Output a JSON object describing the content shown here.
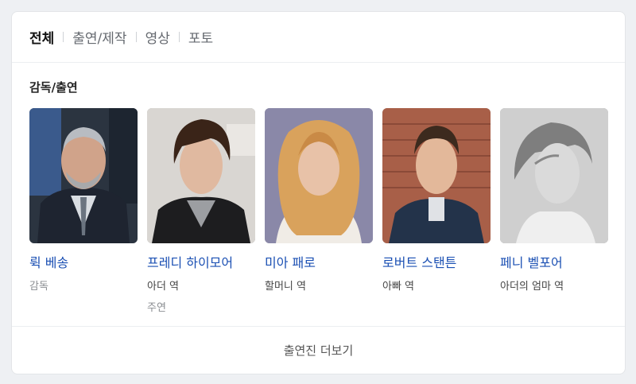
{
  "tabs": [
    {
      "label": "전체",
      "active": true
    },
    {
      "label": "출연/제작",
      "active": false
    },
    {
      "label": "영상",
      "active": false
    },
    {
      "label": "포토",
      "active": false
    }
  ],
  "section_title": "감독/출연",
  "people": [
    {
      "name": "뤽 베송",
      "role": "감독",
      "extra": ""
    },
    {
      "name": "프레디 하이모어",
      "role": "아더 역",
      "extra": "주연"
    },
    {
      "name": "미아 패로",
      "role": "할머니 역",
      "extra": ""
    },
    {
      "name": "로버트 스탠튼",
      "role": "아빠 역",
      "extra": ""
    },
    {
      "name": "페니 벨포어",
      "role": "아더의 엄마 역",
      "extra": ""
    }
  ],
  "more_button": "출연진 더보기",
  "colors": {
    "link": "#1a4fb3",
    "page_bg": "#eef0f3",
    "card_bg": "#ffffff"
  }
}
